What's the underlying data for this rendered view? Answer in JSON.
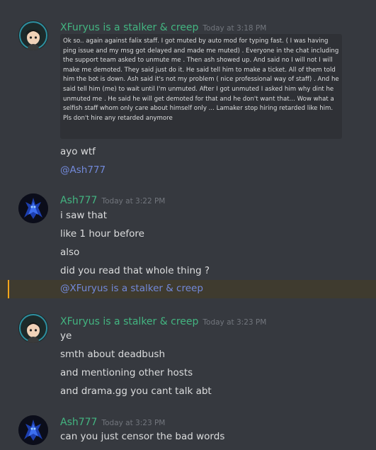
{
  "messages": [
    {
      "author": "XFuryus is a stalker & creep",
      "timestamp": "Today at 3:18 PM",
      "code_block": "Ok so.. again against falix staff. I got muted by auto mod for typing fast. ( I was having ping issue and my msg got delayed and made me muted) . Everyone in the chat including the support team asked to unmute me . Then ash showed up. And said no I will not I will make me demoted. They said just do it. He said tell him to make a ticket. All of them told him the bot is down. Ash said it's not my problem ( nice professional way of staff) . And he said tell him (me) to wait until I'm unmuted. After I got unmuted I asked him why dint he unmuted me . He said he will get demoted for that and he don't want that... Wow what a selfish staff whom only care about himself only ... Lamaker stop hiring retarded like him. Pls don't hire any retarded anymore",
      "lines": [
        "ayo wtf"
      ],
      "mention": "@Ash777"
    },
    {
      "author": "Ash777",
      "timestamp": "Today at 3:22 PM",
      "lines": [
        "i saw that",
        "like 1 hour before",
        "also",
        "did you read that whole thing ?"
      ],
      "mention": "@XFuryus is a stalker & creep"
    },
    {
      "author": "XFuryus is a stalker & creep",
      "timestamp": "Today at 3:23 PM",
      "lines": [
        "ye",
        "smth about deadbush",
        "and mentioning other hosts",
        "and drama.gg you cant talk abt"
      ]
    },
    {
      "author": "Ash777",
      "timestamp": "Today at 3:23 PM",
      "lines": [
        "can you just censor the bad words"
      ]
    }
  ],
  "colors": {
    "background": "#36393f",
    "username": "#43b581",
    "mention": "#7289da",
    "highlight": "#faa61a"
  }
}
